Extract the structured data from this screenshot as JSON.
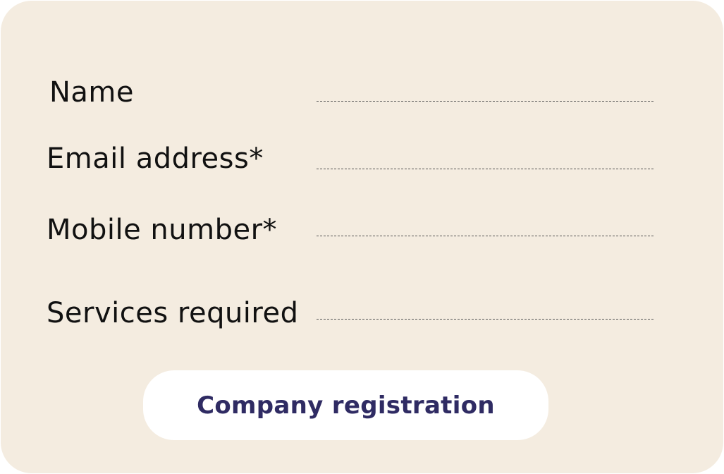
{
  "form": {
    "fields": [
      {
        "label": "Name",
        "value": ""
      },
      {
        "label": "Email address*",
        "value": ""
      },
      {
        "label": "Mobile number*",
        "value": ""
      },
      {
        "label": "Services required",
        "value": ""
      }
    ],
    "submit_label": "Company registration"
  },
  "colors": {
    "card_background": "#f4ece0",
    "button_background": "#ffffff",
    "button_text": "#2f2b63",
    "label_text": "#111111",
    "dashed_line": "#555555"
  }
}
